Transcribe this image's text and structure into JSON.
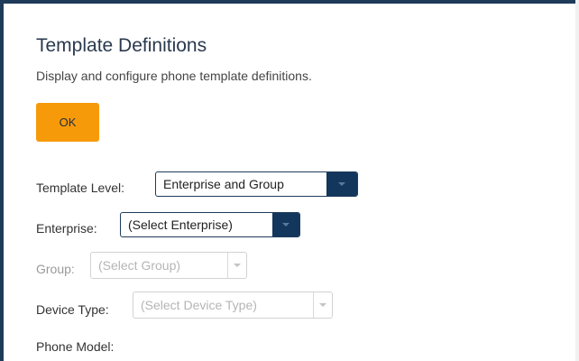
{
  "page": {
    "title": "Template Definitions",
    "subtitle": "Display and configure phone template definitions."
  },
  "actions": {
    "ok_label": "OK"
  },
  "form": {
    "template_level": {
      "label": "Template Level:",
      "value": "Enterprise and Group"
    },
    "enterprise": {
      "label": "Enterprise:",
      "value": "(Select Enterprise)"
    },
    "group": {
      "label": "Group:",
      "value": "(Select Group)",
      "disabled": true
    },
    "device_type": {
      "label": "Device Type:",
      "value": "(Select Device Type)",
      "disabled": true
    },
    "phone_model": {
      "label": "Phone Model:"
    }
  },
  "colors": {
    "accent_orange": "#f79a09",
    "navy": "#13365c"
  },
  "icons": {
    "dropdown": "chevron-down-icon"
  }
}
